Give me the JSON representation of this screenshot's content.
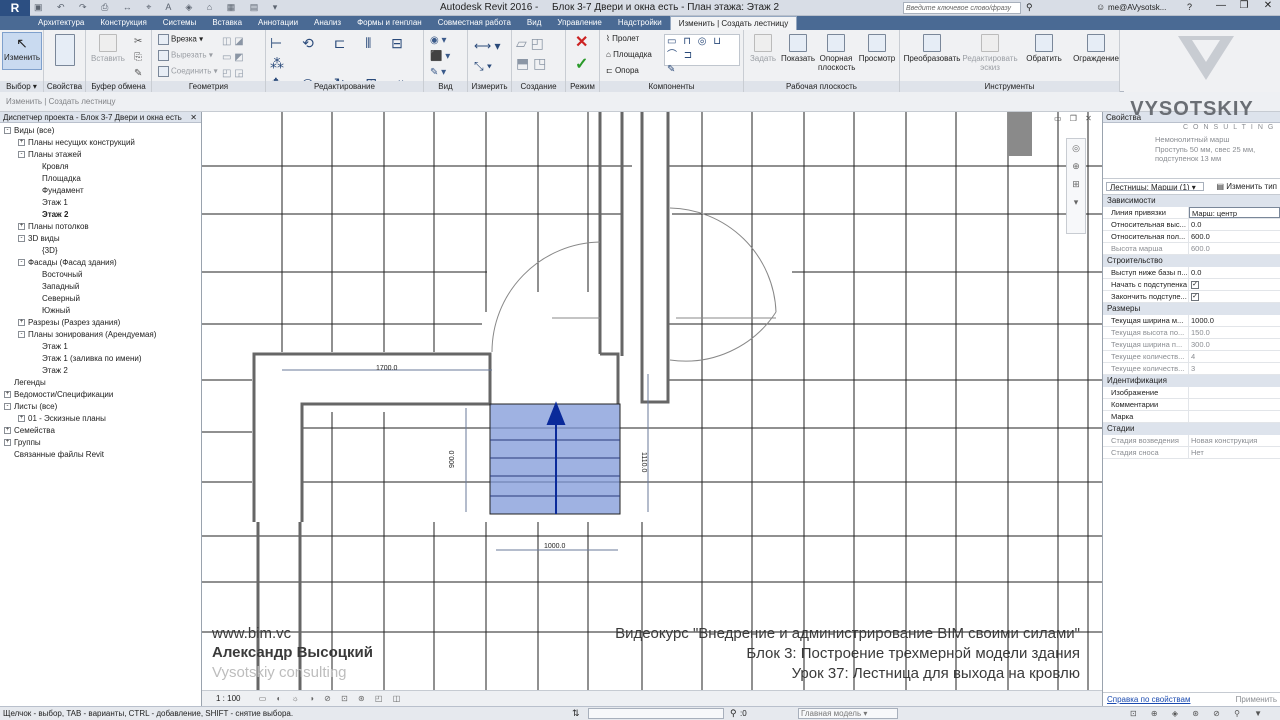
{
  "app": {
    "title": "Autodesk Revit 2016 -",
    "document": "Блок 3-7 Двери и окна есть - План этажа: Этаж 2",
    "search_placeholder": "Введите ключевое слово/фразу",
    "user": "me@AVysotsk..."
  },
  "tabs": [
    "Архитектура",
    "Конструкция",
    "Системы",
    "Вставка",
    "Аннотации",
    "Анализ",
    "Формы и генплан",
    "Совместная работа",
    "Вид",
    "Управление",
    "Надстройки",
    "Изменить | Создать лестницу"
  ],
  "ribbon": {
    "modify": "Изменить",
    "select": "Выбор",
    "properties": "Свойства",
    "clipboard": "Буфер обмена",
    "paste": "Вставить",
    "geometry": "Геометрия",
    "cut": "Врезка",
    "cutout": "Вырезать",
    "join": "Соединить",
    "edit": "Редактирование",
    "view": "Вид",
    "measure": "Измерить",
    "create": "Создание",
    "mode": "Режим",
    "components": "Компоненты",
    "run": "Пролет",
    "landing": "Площадка",
    "support": "Опора",
    "workplane": "Рабочая плоскость",
    "set": "Задать",
    "show": "Показать",
    "ref_plane": "Опорная плоскость",
    "viewer": "Просмотр",
    "tools": "Инструменты",
    "convert": "Преобразовать",
    "edit_sketch": "Редактировать эскиз",
    "flip": "Обратить",
    "railing": "Ограждение"
  },
  "options_bar": "Изменить | Создать лестницу",
  "browser": {
    "title": "Диспетчер проекта - Блок 3-7 Двери и окна есть",
    "items": [
      {
        "l": 0,
        "g": "-",
        "t": "Виды (все)"
      },
      {
        "l": 1,
        "g": "+",
        "t": "Планы несущих конструкций"
      },
      {
        "l": 1,
        "g": "-",
        "t": "Планы этажей"
      },
      {
        "l": 2,
        "g": "",
        "t": "Кровля"
      },
      {
        "l": 2,
        "g": "",
        "t": "Площадка"
      },
      {
        "l": 2,
        "g": "",
        "t": "Фундамент"
      },
      {
        "l": 2,
        "g": "",
        "t": "Этаж 1"
      },
      {
        "l": 2,
        "g": "",
        "t": "Этаж 2",
        "sel": true
      },
      {
        "l": 1,
        "g": "+",
        "t": "Планы потолков"
      },
      {
        "l": 1,
        "g": "-",
        "t": "3D виды"
      },
      {
        "l": 2,
        "g": "",
        "t": "{3D}"
      },
      {
        "l": 1,
        "g": "-",
        "t": "Фасады (Фасад здания)"
      },
      {
        "l": 2,
        "g": "",
        "t": "Восточный"
      },
      {
        "l": 2,
        "g": "",
        "t": "Западный"
      },
      {
        "l": 2,
        "g": "",
        "t": "Северный"
      },
      {
        "l": 2,
        "g": "",
        "t": "Южный"
      },
      {
        "l": 1,
        "g": "+",
        "t": "Разрезы (Разрез здания)"
      },
      {
        "l": 1,
        "g": "-",
        "t": "Планы зонирования (Арендуемая)"
      },
      {
        "l": 2,
        "g": "",
        "t": "Этаж 1"
      },
      {
        "l": 2,
        "g": "",
        "t": "Этаж 1 (заливка по имени)"
      },
      {
        "l": 2,
        "g": "",
        "t": "Этаж 2"
      },
      {
        "l": 0,
        "g": "",
        "t": "Легенды"
      },
      {
        "l": 0,
        "g": "+",
        "t": "Ведомости/Спецификации"
      },
      {
        "l": 0,
        "g": "-",
        "t": "Листы (все)"
      },
      {
        "l": 1,
        "g": "+",
        "t": "01 - Эскизные планы"
      },
      {
        "l": 0,
        "g": "+",
        "t": "Семейства"
      },
      {
        "l": 0,
        "g": "+",
        "t": "Группы"
      },
      {
        "l": 0,
        "g": "",
        "t": "Связанные файлы Revit"
      }
    ]
  },
  "drawing": {
    "dim_top": "1700.0",
    "dim_bottom": "1000.0",
    "dim_left": "900.0",
    "dim_right": "1110.0"
  },
  "view_scale": "1 : 100",
  "watermark": {
    "site": "www.bim.vc",
    "author": "Александр Высоцкий",
    "company": "Vysotskiy consulting",
    "line1": "Видеокурс \"Внедрение и администрирование BIM своими силами\"",
    "line2": "Блок 3: Построение трехмерной модели здания",
    "line3": "Урок 37: Лестница для выхода на кровлю"
  },
  "logo": {
    "name": "VYSOTSKIY",
    "sub": "CONSULTING"
  },
  "properties": {
    "title": "Свойства",
    "type_name": "Немонолитный марш\nПроступь 50 мм, свес 25 мм, подступенок 13 мм",
    "selector": "Лестницы: Марши (1)",
    "edit_type": "Изменить тип",
    "groups": [
      {
        "name": "Зависимости",
        "rows": [
          [
            "Линия привязки",
            "Марш: центр",
            false
          ],
          [
            "Относительная выс...",
            "0.0",
            false
          ],
          [
            "Относительная пол...",
            "600.0",
            false
          ],
          [
            "Высота марша",
            "600.0",
            true
          ]
        ]
      },
      {
        "name": "Строительство",
        "rows": [
          [
            "Выступ ниже базы п...",
            "0.0",
            false
          ],
          [
            "Начать с подступенка",
            "✓",
            false
          ],
          [
            "Закончить подступе...",
            "✓",
            false
          ]
        ]
      },
      {
        "name": "Размеры",
        "rows": [
          [
            "Текущая ширина м...",
            "1000.0",
            false
          ],
          [
            "Текущая высота по...",
            "150.0",
            true
          ],
          [
            "Текущая ширина п...",
            "300.0",
            true
          ],
          [
            "Текущее количеств...",
            "4",
            true
          ],
          [
            "Текущее количеств...",
            "3",
            true
          ]
        ]
      },
      {
        "name": "Идентификация",
        "rows": [
          [
            "Изображение",
            "",
            false
          ],
          [
            "Комментарии",
            "",
            false
          ],
          [
            "Марка",
            "",
            false
          ]
        ]
      },
      {
        "name": "Стадии",
        "rows": [
          [
            "Стадия возведения",
            "Новая конструкция",
            true
          ],
          [
            "Стадия сноса",
            "Нет",
            true
          ]
        ]
      }
    ],
    "help": "Справка по свойствам",
    "apply": "Применить"
  },
  "status": {
    "hint": "Щелчок - выбор, TAB - варианты, CTRL - добавление, SHIFT - снятие выбора.",
    "zero": ":0",
    "model": "Главная модель"
  }
}
